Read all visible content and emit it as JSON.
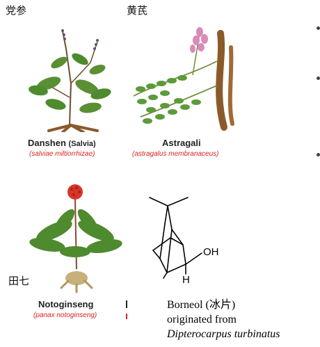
{
  "labels": {
    "dangshen_cn": "党参",
    "huangqi_cn": "黄芪",
    "tianqi_cn": "田七"
  },
  "herbs": [
    {
      "name": "Danshen",
      "paren": "(Salvia)",
      "latin": "(salviae miltiorrhizae)"
    },
    {
      "name": "Astragali",
      "paren": "",
      "latin": "(astragalus membranaceus)"
    },
    {
      "name": "Notoginseng",
      "paren": "",
      "latin": "(panax notoginseng)"
    }
  ],
  "molecule": {
    "oh_label": "OH",
    "h_label": "H"
  },
  "caption": {
    "line1": "Borneol (冰片)",
    "line2": "originated from",
    "line3": "Dipterocarpus turbinatus"
  },
  "colors": {
    "latin_text": "#dd2222",
    "leaf_green": "#4e8a2e",
    "root_brown": "#8a5a2b",
    "flower_pink": "#d98ab8",
    "berry_red": "#d8352a"
  }
}
